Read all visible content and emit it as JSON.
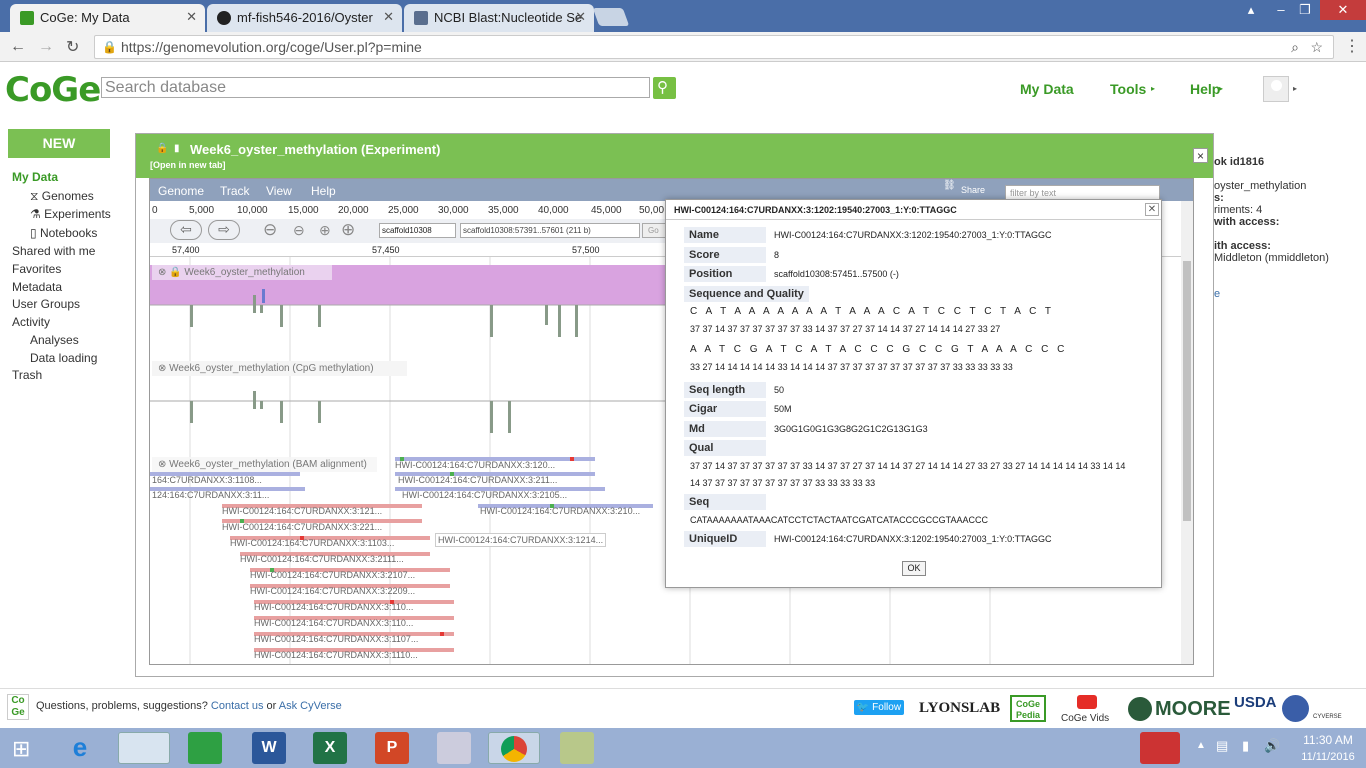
{
  "browser": {
    "tabs": [
      {
        "title": "CoGe: My Data"
      },
      {
        "title": "mf-fish546-2016/Oyster"
      },
      {
        "title": "NCBI Blast:Nucleotide Se"
      }
    ],
    "url": "https://genomevolution.org/coge/User.pl?p=mine"
  },
  "header": {
    "logo": "CoGe",
    "search_placeholder": "Search database",
    "nav": [
      "My Data",
      "Tools",
      "Help"
    ]
  },
  "sidebar": {
    "new_label": "NEW",
    "items": [
      "My Data",
      "Genomes",
      "Experiments",
      "Notebooks",
      "Shared with me",
      "Favorites",
      "Metadata",
      "User Groups",
      "Activity",
      "Analyses",
      "Data loading",
      "Trash"
    ]
  },
  "right_panel": {
    "lines": [
      "ok id1816",
      "oyster_methylation",
      "s:",
      "riments: 4",
      "with access:",
      "ith access:",
      "Middleton (mmiddleton)",
      "e"
    ]
  },
  "modal": {
    "title": "Week6_oyster_methylation (Experiment)",
    "open_new_tab": "[Open in new tab]",
    "close": "×",
    "filter_placeholder": "filter by text"
  },
  "jbrowse": {
    "menu": [
      "Genome",
      "Track",
      "View",
      "Help"
    ],
    "share": "Share",
    "ruler": [
      "0",
      "5,000",
      "10,000",
      "15,000",
      "20,000",
      "25,000",
      "30,000",
      "35,000",
      "40,000",
      "45,000",
      "50,00"
    ],
    "scaffold": "scaffold10308",
    "location": "scaffold10308:57391..57601 (211 b)",
    "go": "Go",
    "positions": [
      "57,400",
      "57,450",
      "57,500"
    ],
    "tracks": [
      "Week6_oyster_methylation",
      "Week6_oyster_methylation (CpG methylation)",
      "Week6_oyster_methylation (BAM alignment)"
    ],
    "reads": [
      "HWI-C00124:164:C7URDANXX:3:120...",
      "164:C7URDANXX:3:1108...",
      "HWI-C00124:164:C7URDANXX:3:211...",
      "124:164:C7URDANXX:3:11...",
      "HWI-C00124:164:C7URDANXX:3:2105...",
      "HWI-C00124:164:C7URDANXX:3:121...",
      "HWI-C00124:164:C7URDANXX:3:210...",
      "HWI-C00124:164:C7URDANXX:3:221...",
      "HWI-C00124:164:C7URDANXX:3:1103...",
      "HWI-C00124:164:C7URDANXX:3:1214...",
      "HWI-C00124:164:C7URDANXX:3:2111...",
      "HWI-C00124:164:C7URDANXX:3:2107...",
      "HWI-C00124:164:C7URDANXX:3:2209...",
      "HWI-C00124:164:C7URDANXX:3:110...",
      "HWI-C00124:164:C7URDANXX:3:110...",
      "HWI-C00124:164:C7URDANXX:3:1107...",
      "HWI-C00124:164:C7URDANXX:3:1110..."
    ]
  },
  "popup": {
    "title": "HWI-C00124:164:C7URDANXX:3:1202:19540:27003_1:Y:0:TTAGGC",
    "name_label": "Name",
    "name": "HWI-C00124:164:C7URDANXX:3:1202:19540:27003_1:Y:0:TTAGGC",
    "score_label": "Score",
    "score": "8",
    "position_label": "Position",
    "position": "scaffold10308:57451..57500 (-)",
    "seqqual_label": "Sequence and Quality",
    "seq1": "C A T A A A A A A A T A A A C A T C C T C T A C T",
    "qual1": "37 37 14 37 37 37 37 37 37 33 14 37 37 27 37 14 14 37 27 14 14 14 27 33 27",
    "seq2": "A A T C G A T C A T A C C C G C C G T A A A C C C",
    "qual2": "33 27 14 14 14 14 14 33 14 14 14 37 37 37 37 37 37 37 37 37 37 33 33 33 33 33",
    "seqlen_label": "Seq length",
    "seqlen": "50",
    "cigar_label": "Cigar",
    "cigar": "50M",
    "md_label": "Md",
    "md": "3G0G1G0G1G3G8G2G1C2G13G1G3",
    "qual_label": "Qual",
    "qual_a": "37 37 14 37 37 37 37 37 37 33 14 37 37 27 37 14 14 37 27 14 14 14 27 33 27 33 27 14 14 14 14 14 33 14 14",
    "qual_b": "14 37 37 37 37 37 37 37 37 37 33 33 33 33 33",
    "seq_label": "Seq",
    "seq": "CATAAAAAAATAAACATCCTCTACTAATCGATCATACCCGCCGTAAACCC",
    "uid_label": "UniqueID",
    "uid": "HWI-C00124:164:C7URDANXX:3:1202:19540:27003_1:Y:0:TTAGGC",
    "ok": "OK"
  },
  "footer": {
    "text1": "Questions, problems, suggestions?",
    "contact": "Contact us",
    "or": "or",
    "ask": "Ask CyVerse",
    "follow": "Follow",
    "logos": [
      "LYONSLAB",
      "CoGe Pedia",
      "CoGe Vids",
      "MOORE",
      "USDA",
      "CYVERSE"
    ]
  },
  "taskbar": {
    "time": "11:30 AM",
    "date": "11/11/2016"
  }
}
